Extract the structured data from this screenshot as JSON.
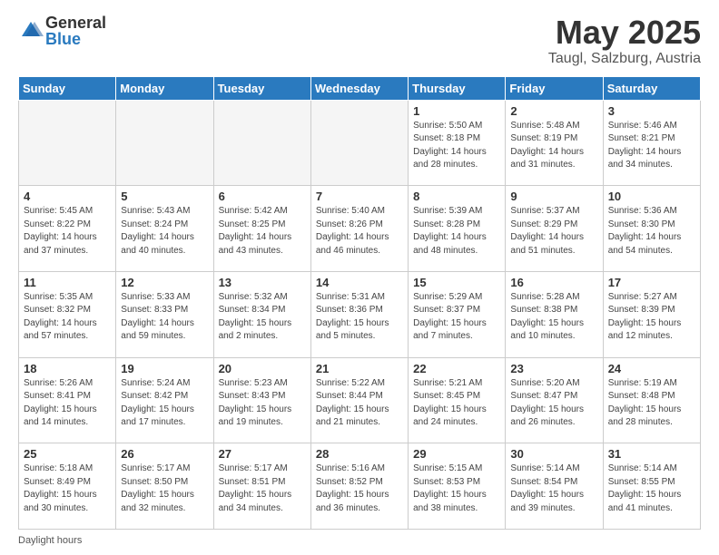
{
  "header": {
    "logo_general": "General",
    "logo_blue": "Blue",
    "title": "May 2025",
    "subtitle": "Taugl, Salzburg, Austria"
  },
  "weekdays": [
    "Sunday",
    "Monday",
    "Tuesday",
    "Wednesday",
    "Thursday",
    "Friday",
    "Saturday"
  ],
  "footnote": "Daylight hours",
  "weeks": [
    [
      {
        "day": "",
        "info": ""
      },
      {
        "day": "",
        "info": ""
      },
      {
        "day": "",
        "info": ""
      },
      {
        "day": "",
        "info": ""
      },
      {
        "day": "1",
        "info": "Sunrise: 5:50 AM\nSunset: 8:18 PM\nDaylight: 14 hours\nand 28 minutes."
      },
      {
        "day": "2",
        "info": "Sunrise: 5:48 AM\nSunset: 8:19 PM\nDaylight: 14 hours\nand 31 minutes."
      },
      {
        "day": "3",
        "info": "Sunrise: 5:46 AM\nSunset: 8:21 PM\nDaylight: 14 hours\nand 34 minutes."
      }
    ],
    [
      {
        "day": "4",
        "info": "Sunrise: 5:45 AM\nSunset: 8:22 PM\nDaylight: 14 hours\nand 37 minutes."
      },
      {
        "day": "5",
        "info": "Sunrise: 5:43 AM\nSunset: 8:24 PM\nDaylight: 14 hours\nand 40 minutes."
      },
      {
        "day": "6",
        "info": "Sunrise: 5:42 AM\nSunset: 8:25 PM\nDaylight: 14 hours\nand 43 minutes."
      },
      {
        "day": "7",
        "info": "Sunrise: 5:40 AM\nSunset: 8:26 PM\nDaylight: 14 hours\nand 46 minutes."
      },
      {
        "day": "8",
        "info": "Sunrise: 5:39 AM\nSunset: 8:28 PM\nDaylight: 14 hours\nand 48 minutes."
      },
      {
        "day": "9",
        "info": "Sunrise: 5:37 AM\nSunset: 8:29 PM\nDaylight: 14 hours\nand 51 minutes."
      },
      {
        "day": "10",
        "info": "Sunrise: 5:36 AM\nSunset: 8:30 PM\nDaylight: 14 hours\nand 54 minutes."
      }
    ],
    [
      {
        "day": "11",
        "info": "Sunrise: 5:35 AM\nSunset: 8:32 PM\nDaylight: 14 hours\nand 57 minutes."
      },
      {
        "day": "12",
        "info": "Sunrise: 5:33 AM\nSunset: 8:33 PM\nDaylight: 14 hours\nand 59 minutes."
      },
      {
        "day": "13",
        "info": "Sunrise: 5:32 AM\nSunset: 8:34 PM\nDaylight: 15 hours\nand 2 minutes."
      },
      {
        "day": "14",
        "info": "Sunrise: 5:31 AM\nSunset: 8:36 PM\nDaylight: 15 hours\nand 5 minutes."
      },
      {
        "day": "15",
        "info": "Sunrise: 5:29 AM\nSunset: 8:37 PM\nDaylight: 15 hours\nand 7 minutes."
      },
      {
        "day": "16",
        "info": "Sunrise: 5:28 AM\nSunset: 8:38 PM\nDaylight: 15 hours\nand 10 minutes."
      },
      {
        "day": "17",
        "info": "Sunrise: 5:27 AM\nSunset: 8:39 PM\nDaylight: 15 hours\nand 12 minutes."
      }
    ],
    [
      {
        "day": "18",
        "info": "Sunrise: 5:26 AM\nSunset: 8:41 PM\nDaylight: 15 hours\nand 14 minutes."
      },
      {
        "day": "19",
        "info": "Sunrise: 5:24 AM\nSunset: 8:42 PM\nDaylight: 15 hours\nand 17 minutes."
      },
      {
        "day": "20",
        "info": "Sunrise: 5:23 AM\nSunset: 8:43 PM\nDaylight: 15 hours\nand 19 minutes."
      },
      {
        "day": "21",
        "info": "Sunrise: 5:22 AM\nSunset: 8:44 PM\nDaylight: 15 hours\nand 21 minutes."
      },
      {
        "day": "22",
        "info": "Sunrise: 5:21 AM\nSunset: 8:45 PM\nDaylight: 15 hours\nand 24 minutes."
      },
      {
        "day": "23",
        "info": "Sunrise: 5:20 AM\nSunset: 8:47 PM\nDaylight: 15 hours\nand 26 minutes."
      },
      {
        "day": "24",
        "info": "Sunrise: 5:19 AM\nSunset: 8:48 PM\nDaylight: 15 hours\nand 28 minutes."
      }
    ],
    [
      {
        "day": "25",
        "info": "Sunrise: 5:18 AM\nSunset: 8:49 PM\nDaylight: 15 hours\nand 30 minutes."
      },
      {
        "day": "26",
        "info": "Sunrise: 5:17 AM\nSunset: 8:50 PM\nDaylight: 15 hours\nand 32 minutes."
      },
      {
        "day": "27",
        "info": "Sunrise: 5:17 AM\nSunset: 8:51 PM\nDaylight: 15 hours\nand 34 minutes."
      },
      {
        "day": "28",
        "info": "Sunrise: 5:16 AM\nSunset: 8:52 PM\nDaylight: 15 hours\nand 36 minutes."
      },
      {
        "day": "29",
        "info": "Sunrise: 5:15 AM\nSunset: 8:53 PM\nDaylight: 15 hours\nand 38 minutes."
      },
      {
        "day": "30",
        "info": "Sunrise: 5:14 AM\nSunset: 8:54 PM\nDaylight: 15 hours\nand 39 minutes."
      },
      {
        "day": "31",
        "info": "Sunrise: 5:14 AM\nSunset: 8:55 PM\nDaylight: 15 hours\nand 41 minutes."
      }
    ]
  ]
}
